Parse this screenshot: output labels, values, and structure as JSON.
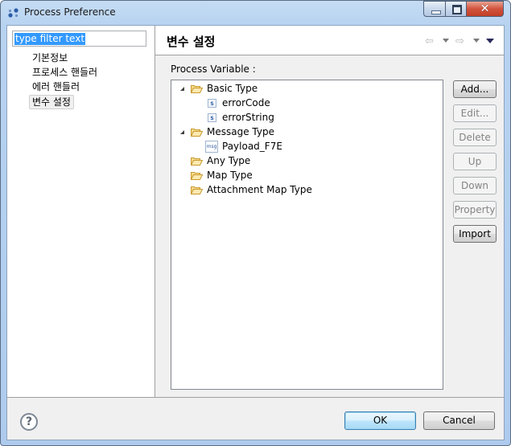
{
  "window": {
    "title": "Process Preference",
    "close_glyph": "✕"
  },
  "sidebar": {
    "filter_value": "type filter text",
    "items": [
      {
        "label": "기본정보"
      },
      {
        "label": "프로세스 핸들러"
      },
      {
        "label": "에러 핸들러"
      },
      {
        "label": "변수 설정",
        "selected": true
      }
    ]
  },
  "page": {
    "title": "변수 설정",
    "back_glyph": "⇦",
    "forward_glyph": "⇨",
    "section_label": "Process Variable :"
  },
  "tree": {
    "nodes": [
      {
        "label": "Basic Type",
        "type": "folder",
        "expanded": true,
        "level": 0
      },
      {
        "label": "errorCode",
        "type": "string",
        "icon_text": "s",
        "level": 1
      },
      {
        "label": "errorString",
        "type": "string",
        "icon_text": "s",
        "level": 1
      },
      {
        "label": "Message Type",
        "type": "folder",
        "expanded": true,
        "level": 0
      },
      {
        "label": "Payload_F7E",
        "type": "message",
        "icon_text": "msg",
        "level": 1
      },
      {
        "label": "Any Type",
        "type": "folder",
        "expanded": false,
        "level": 0
      },
      {
        "label": "Map Type",
        "type": "folder",
        "expanded": false,
        "level": 0
      },
      {
        "label": "Attachment Map Type",
        "type": "folder",
        "expanded": false,
        "level": 0
      }
    ]
  },
  "buttons": {
    "add": "Add...",
    "edit": "Edit...",
    "delete": "Delete",
    "up": "Up",
    "down": "Down",
    "property": "Property",
    "import": "Import"
  },
  "footer": {
    "help_glyph": "?",
    "ok": "OK",
    "cancel": "Cancel"
  }
}
